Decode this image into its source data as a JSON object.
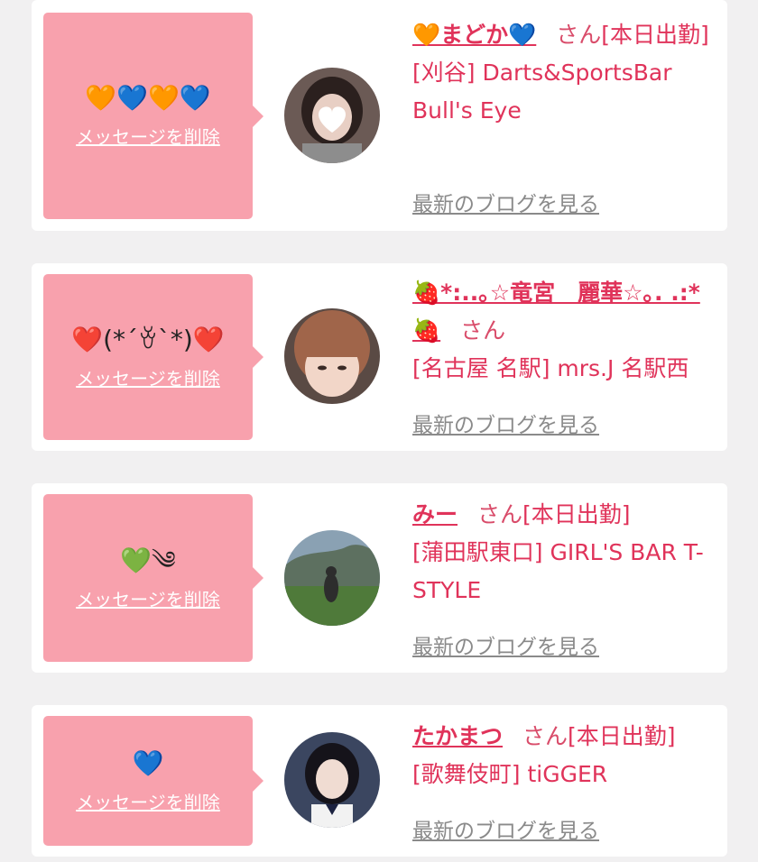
{
  "common": {
    "delete_label": "メッセージを削除",
    "blog_label": "最新のブログを見る",
    "san": "さん"
  },
  "cards": [
    {
      "message": "🧡💙🧡💙",
      "name": "🧡まどか💙",
      "status": "[本日出勤]",
      "shop": "[刈谷] Darts&SportsBar Bull's Eye",
      "avatar_icon": "avatar-photo-icon"
    },
    {
      "message": "❤️(*´ꈊ`*)❤️",
      "name": "🍓*:..｡☆竜宮　麗華☆｡. .:*🍓",
      "status": "",
      "shop": "[名古屋 名駅] mrs.J 名駅西",
      "avatar_icon": "avatar-photo-icon"
    },
    {
      "message": "💚༄",
      "name": "みー",
      "status": "[本日出勤]",
      "shop": "[蒲田駅東口] GIRL'S BAR T-STYLE",
      "avatar_icon": "avatar-photo-icon"
    },
    {
      "message": "💙",
      "name": "たかまつ",
      "status": "[本日出勤]",
      "shop": "[歌舞伎町] tiGGER",
      "avatar_icon": "avatar-photo-icon"
    }
  ],
  "colors": {
    "accent": "#e0335a",
    "bubble": "#f8a1ad",
    "link_gray": "#8a8a8a",
    "page_bg": "#f1f0f1"
  }
}
